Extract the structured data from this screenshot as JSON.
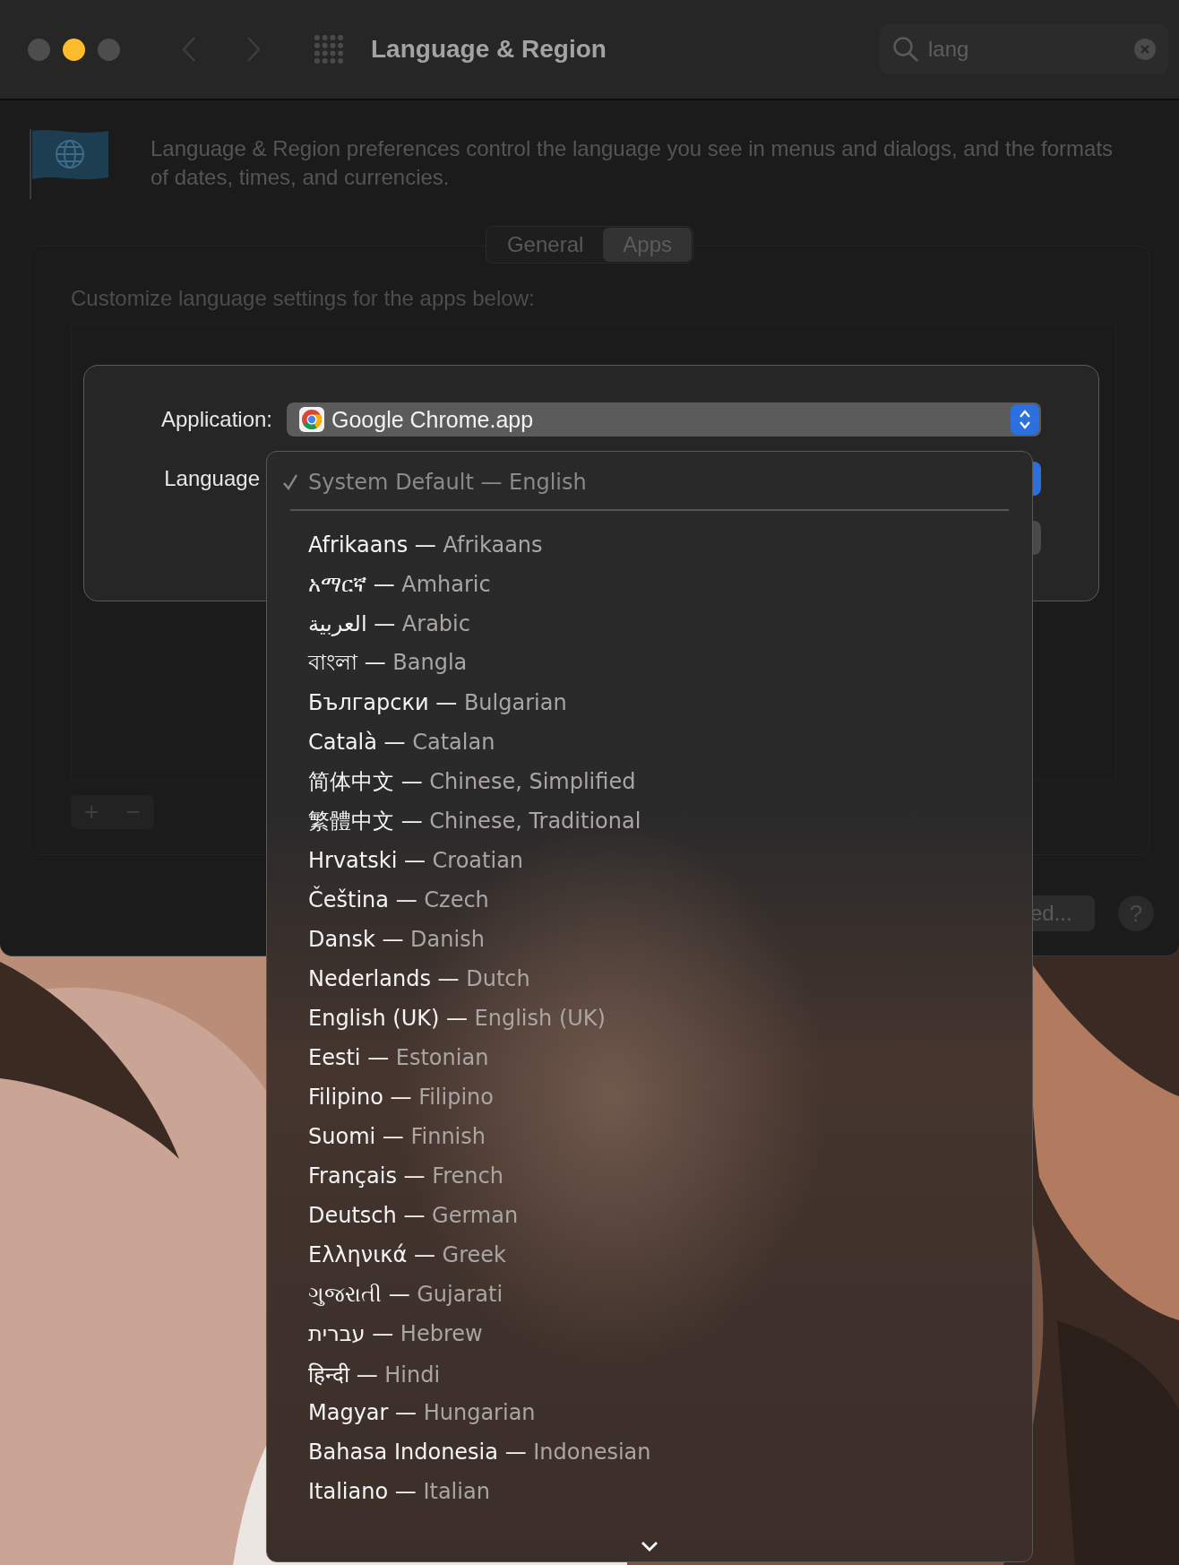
{
  "window": {
    "title": "Language & Region"
  },
  "search": {
    "value": "lang"
  },
  "description": "Language & Region preferences control the language you see in menus and dialogs, and the formats of dates, times, and currencies.",
  "tabs": [
    {
      "label": "General",
      "selected": false
    },
    {
      "label": "Apps",
      "selected": true
    }
  ],
  "apps_caption": "Customize language settings for the apps below:",
  "list_buttons": [
    "+",
    "−"
  ],
  "sheet": {
    "application_label": "Application:",
    "application_value": "Google Chrome.app",
    "language_label": "Language"
  },
  "footer": {
    "partial_button": "ed...",
    "help_button": "?"
  },
  "menu": {
    "joiner": " — ",
    "items": [
      {
        "native": "System Default",
        "english": "English",
        "checked": true,
        "disabled": true
      },
      {
        "native": "Afrikaans",
        "english": "Afrikaans",
        "checked": false,
        "disabled": false
      },
      {
        "native": "አማርኛ",
        "english": "Amharic",
        "checked": false,
        "disabled": false
      },
      {
        "native": "العربية",
        "english": "Arabic",
        "checked": false,
        "disabled": false
      },
      {
        "native": "বাংলা",
        "english": "Bangla",
        "checked": false,
        "disabled": false
      },
      {
        "native": "Български",
        "english": "Bulgarian",
        "checked": false,
        "disabled": false
      },
      {
        "native": "Català",
        "english": "Catalan",
        "checked": false,
        "disabled": false
      },
      {
        "native": "简体中文",
        "english": "Chinese, Simplified",
        "checked": false,
        "disabled": false
      },
      {
        "native": "繁體中文",
        "english": "Chinese, Traditional",
        "checked": false,
        "disabled": false
      },
      {
        "native": "Hrvatski",
        "english": "Croatian",
        "checked": false,
        "disabled": false
      },
      {
        "native": "Čeština",
        "english": "Czech",
        "checked": false,
        "disabled": false
      },
      {
        "native": "Dansk",
        "english": "Danish",
        "checked": false,
        "disabled": false
      },
      {
        "native": "Nederlands",
        "english": "Dutch",
        "checked": false,
        "disabled": false
      },
      {
        "native": "English (UK)",
        "english": "English (UK)",
        "checked": false,
        "disabled": false
      },
      {
        "native": "Eesti",
        "english": "Estonian",
        "checked": false,
        "disabled": false
      },
      {
        "native": "Filipino",
        "english": "Filipino",
        "checked": false,
        "disabled": false
      },
      {
        "native": "Suomi",
        "english": "Finnish",
        "checked": false,
        "disabled": false
      },
      {
        "native": "Français",
        "english": "French",
        "checked": false,
        "disabled": false
      },
      {
        "native": "Deutsch",
        "english": "German",
        "checked": false,
        "disabled": false
      },
      {
        "native": "Ελληνικά",
        "english": "Greek",
        "checked": false,
        "disabled": false
      },
      {
        "native": "ગુજરાતી",
        "english": "Gujarati",
        "checked": false,
        "disabled": false
      },
      {
        "native": "עברית",
        "english": "Hebrew",
        "checked": false,
        "disabled": false
      },
      {
        "native": "हिन्दी",
        "english": "Hindi",
        "checked": false,
        "disabled": false
      },
      {
        "native": "Magyar",
        "english": "Hungarian",
        "checked": false,
        "disabled": false
      },
      {
        "native": "Bahasa Indonesia",
        "english": "Indonesian",
        "checked": false,
        "disabled": false
      },
      {
        "native": "Italiano",
        "english": "Italian",
        "checked": false,
        "disabled": false
      }
    ]
  }
}
